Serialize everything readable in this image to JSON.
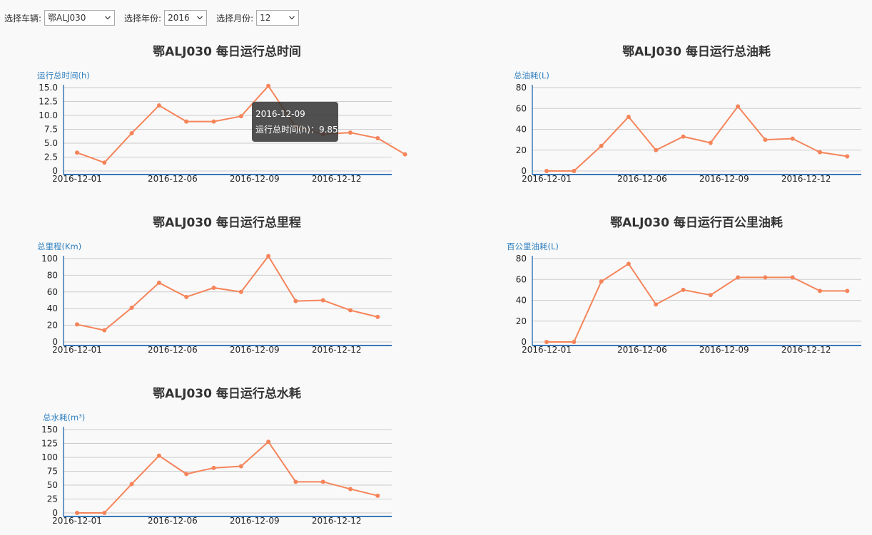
{
  "controls": {
    "vehicle_label": "选择车辆:",
    "vehicle_value": "鄂ALJ030",
    "year_label": "选择年份:",
    "year_value": "2016",
    "month_label": "选择月份:",
    "month_value": "12"
  },
  "colors": {
    "line": "#f5845a",
    "axis": "#3a78b8",
    "grid": "#cccccc",
    "axis_name": "#2f7fbf"
  },
  "tooltip": {
    "date": "2016-12-09",
    "text": "运行总时间(h)：9.85"
  },
  "chart_data": [
    {
      "type": "line",
      "title": "鄂ALJ030 每日运行总时间",
      "ylabel": "运行总时间(h)",
      "x": [
        "2016-12-01",
        "2016-12-03",
        "2016-12-04",
        "2016-12-05",
        "2016-12-06",
        "2016-12-07",
        "2016-12-08",
        "2016-12-09",
        "2016-12-10",
        "2016-12-11",
        "2016-12-12",
        "2016-12-13",
        "2016-12-14"
      ],
      "values": [
        3.3,
        1.5,
        6.8,
        11.8,
        8.9,
        8.9,
        9.85,
        15.3,
        7.9,
        6.6,
        6.9,
        5.9,
        3.0
      ],
      "ylim": [
        0,
        15
      ],
      "yticks": [
        "15.0",
        "12.5",
        "10.0",
        "7.5",
        "5.0",
        "2.5",
        "0"
      ],
      "xticklabels": [
        "2016-12-01",
        "2016-12-06",
        "2016-12-09",
        "2016-12-12"
      ],
      "grid": true
    },
    {
      "type": "line",
      "title": "鄂ALJ030 每日运行总油耗",
      "ylabel": "总油耗(L)",
      "x": [
        "2016-12-01",
        "2016-12-03",
        "2016-12-04",
        "2016-12-05",
        "2016-12-06",
        "2016-12-07",
        "2016-12-08",
        "2016-12-09",
        "2016-12-10",
        "2016-12-11",
        "2016-12-12",
        "2016-12-13",
        "2016-12-14"
      ],
      "values": [
        0,
        0,
        24,
        52,
        20,
        33,
        27,
        62,
        30,
        31,
        18,
        14,
        null
      ],
      "ylim": [
        0,
        80
      ],
      "yticks": [
        "80",
        "60",
        "40",
        "20",
        "0"
      ],
      "xticklabels": [
        "2016-12-01",
        "2016-12-06",
        "2016-12-09",
        "2016-12-12"
      ],
      "grid": true
    },
    {
      "type": "line",
      "title": "鄂ALJ030 每日运行总里程",
      "ylabel": "总里程(Km)",
      "x": [
        "2016-12-01",
        "2016-12-03",
        "2016-12-04",
        "2016-12-05",
        "2016-12-06",
        "2016-12-07",
        "2016-12-08",
        "2016-12-09",
        "2016-12-10",
        "2016-12-11",
        "2016-12-12",
        "2016-12-13",
        "2016-12-14"
      ],
      "values": [
        21,
        14,
        41,
        71,
        54,
        65,
        60,
        103,
        49,
        50,
        38,
        30
      ],
      "ylim": [
        0,
        100
      ],
      "yticks": [
        "100",
        "80",
        "60",
        "40",
        "20",
        "0"
      ],
      "xticklabels": [
        "2016-12-01",
        "2016-12-06",
        "2016-12-09",
        "2016-12-12"
      ],
      "grid": true
    },
    {
      "type": "line",
      "title": "鄂ALJ030 每日运行百公里油耗",
      "ylabel": "百公里油耗(L)",
      "x": [
        "2016-12-01",
        "2016-12-03",
        "2016-12-04",
        "2016-12-05",
        "2016-12-06",
        "2016-12-07",
        "2016-12-08",
        "2016-12-09",
        "2016-12-10",
        "2016-12-11",
        "2016-12-12",
        "2016-12-13",
        "2016-12-14"
      ],
      "values": [
        0,
        0,
        58,
        75,
        36,
        50,
        45,
        62,
        62,
        62,
        49,
        49
      ],
      "ylim": [
        0,
        80
      ],
      "yticks": [
        "80",
        "60",
        "40",
        "20",
        "0"
      ],
      "xticklabels": [
        "2016-12-01",
        "2016-12-06",
        "2016-12-09",
        "2016-12-12"
      ],
      "grid": true
    },
    {
      "type": "line",
      "title": "鄂ALJ030 每日运行总水耗",
      "ylabel": "总水耗(m³)",
      "x": [
        "2016-12-01",
        "2016-12-03",
        "2016-12-04",
        "2016-12-05",
        "2016-12-06",
        "2016-12-07",
        "2016-12-08",
        "2016-12-09",
        "2016-12-10",
        "2016-12-11",
        "2016-12-12",
        "2016-12-13",
        "2016-12-14"
      ],
      "values": [
        0,
        0,
        52,
        103,
        70,
        81,
        84,
        128,
        56,
        56,
        43,
        31
      ],
      "ylim": [
        0,
        150
      ],
      "yticks": [
        "150",
        "125",
        "100",
        "75",
        "50",
        "25",
        "0"
      ],
      "xticklabels": [
        "2016-12-01",
        "2016-12-06",
        "2016-12-09",
        "2016-12-12"
      ],
      "grid": true
    }
  ]
}
